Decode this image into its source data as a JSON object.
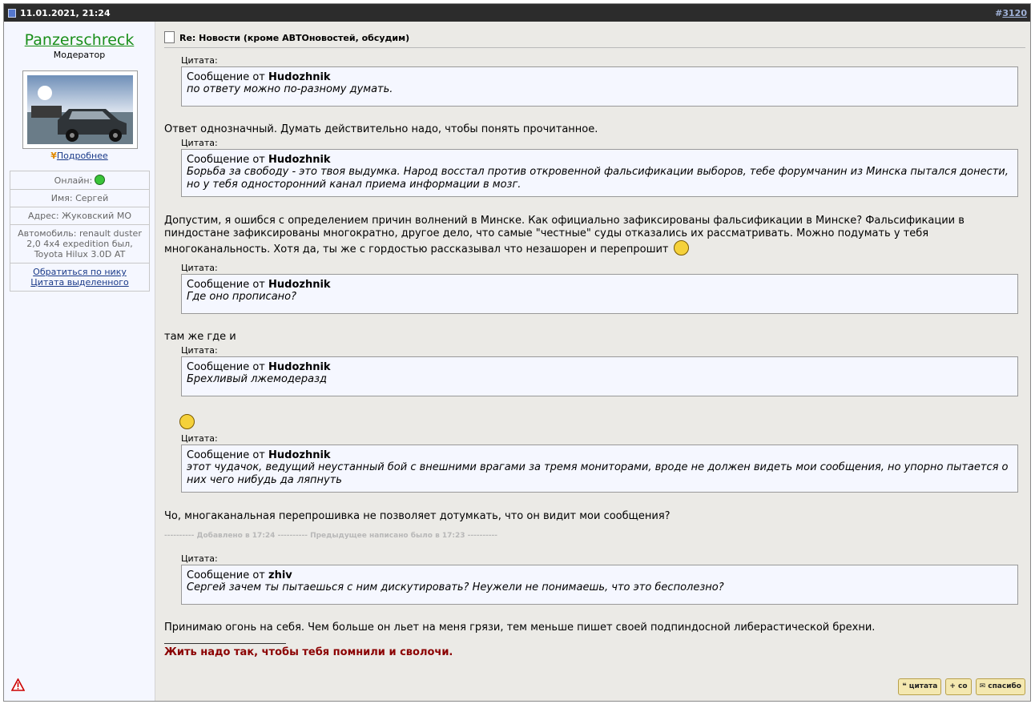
{
  "header": {
    "date": "11.01.2021, 21:24",
    "post_number_prefix": "#",
    "post_number": "3120"
  },
  "user": {
    "name": "Panzerschreck",
    "role": "Модератор",
    "more_link": "Подробнее",
    "online_label": "Онлайн:",
    "name_row": "Имя: Сергей",
    "address_row": "Адрес: Жуковский МО",
    "car_row": "Автомобиль: renault duster 2,0 4x4 expedition был, Toyota Hilux 3.0D AT",
    "link_address": "Обратиться по нику",
    "link_quote": "Цитата выделенного"
  },
  "post": {
    "title": "Re: Новости (кроме АВТОновостей, обсудим)",
    "quote_label": "Цитата:",
    "quote_from": "Сообщение от",
    "blocks": {
      "q1_author": "Hudozhnik",
      "q1_text": "по ответу можно по-разному думать.",
      "p1": "Ответ однозначный. Думать действительно надо, чтобы понять прочитанное.",
      "q2_author": "Hudozhnik",
      "q2_text": "Борьба за свободу - это твоя выдумка. Народ восстал против откровенной фальсификации выборов, тебе форумчанин из Минска пытался донести, но у тебя односторонний канал приема информации в мозг.",
      "p2": "Допустим, я ошибся с определением причин волнений в Минске. Как официально зафиксированы фальсификации в Минске? Фальсификации в пиндостане зафиксированы многократно, другое дело, что самые \"честные\" суды отказались их рассматривать. Можно подумать у тебя многоканальность. Хотя да, ты же с гордостью рассказывал что незашорен и перепрошит",
      "q3_author": "Hudozhnik",
      "q3_text": "Где оно прописано?",
      "p3": "там же где и",
      "q4_author": "Hudozhnik",
      "q4_text": "Брехливый лжемодеразд",
      "q5_author": "Hudozhnik",
      "q5_text": "этот чудачок, ведущий неустанный бой с внешними врагами за тремя мониторами, вроде не должен видеть мои сообщения, но упорно пытается о них чего нибудь да ляпнуть",
      "p5": "Чо, многаканальная перепрошивка не позволяет дотумкать, что он видит мои сообщения?",
      "added": "---------- Добавлено в 17:24 ---------- Предыдущее написано было в 17:23 ----------",
      "q6_author": "zhiv",
      "q6_text": "Сергей зачем ты пытаешься с ним дискутировать? Неужели не понимаешь, что это бесполезно?",
      "p6": "Принимаю огонь на себя. Чем больше он льет на меня грязи, тем меньше пишет своей подпиндосной либерастической брехни."
    },
    "signature": "Жить надо так, чтобы тебя помнили и сволочи."
  },
  "buttons": {
    "quote": "цитата",
    "multiquote": "со",
    "thanks": "спасибо"
  },
  "colors": {
    "header_bg": "#2c2c2c",
    "username": "#1a8f1a",
    "signature": "#8b0000"
  }
}
